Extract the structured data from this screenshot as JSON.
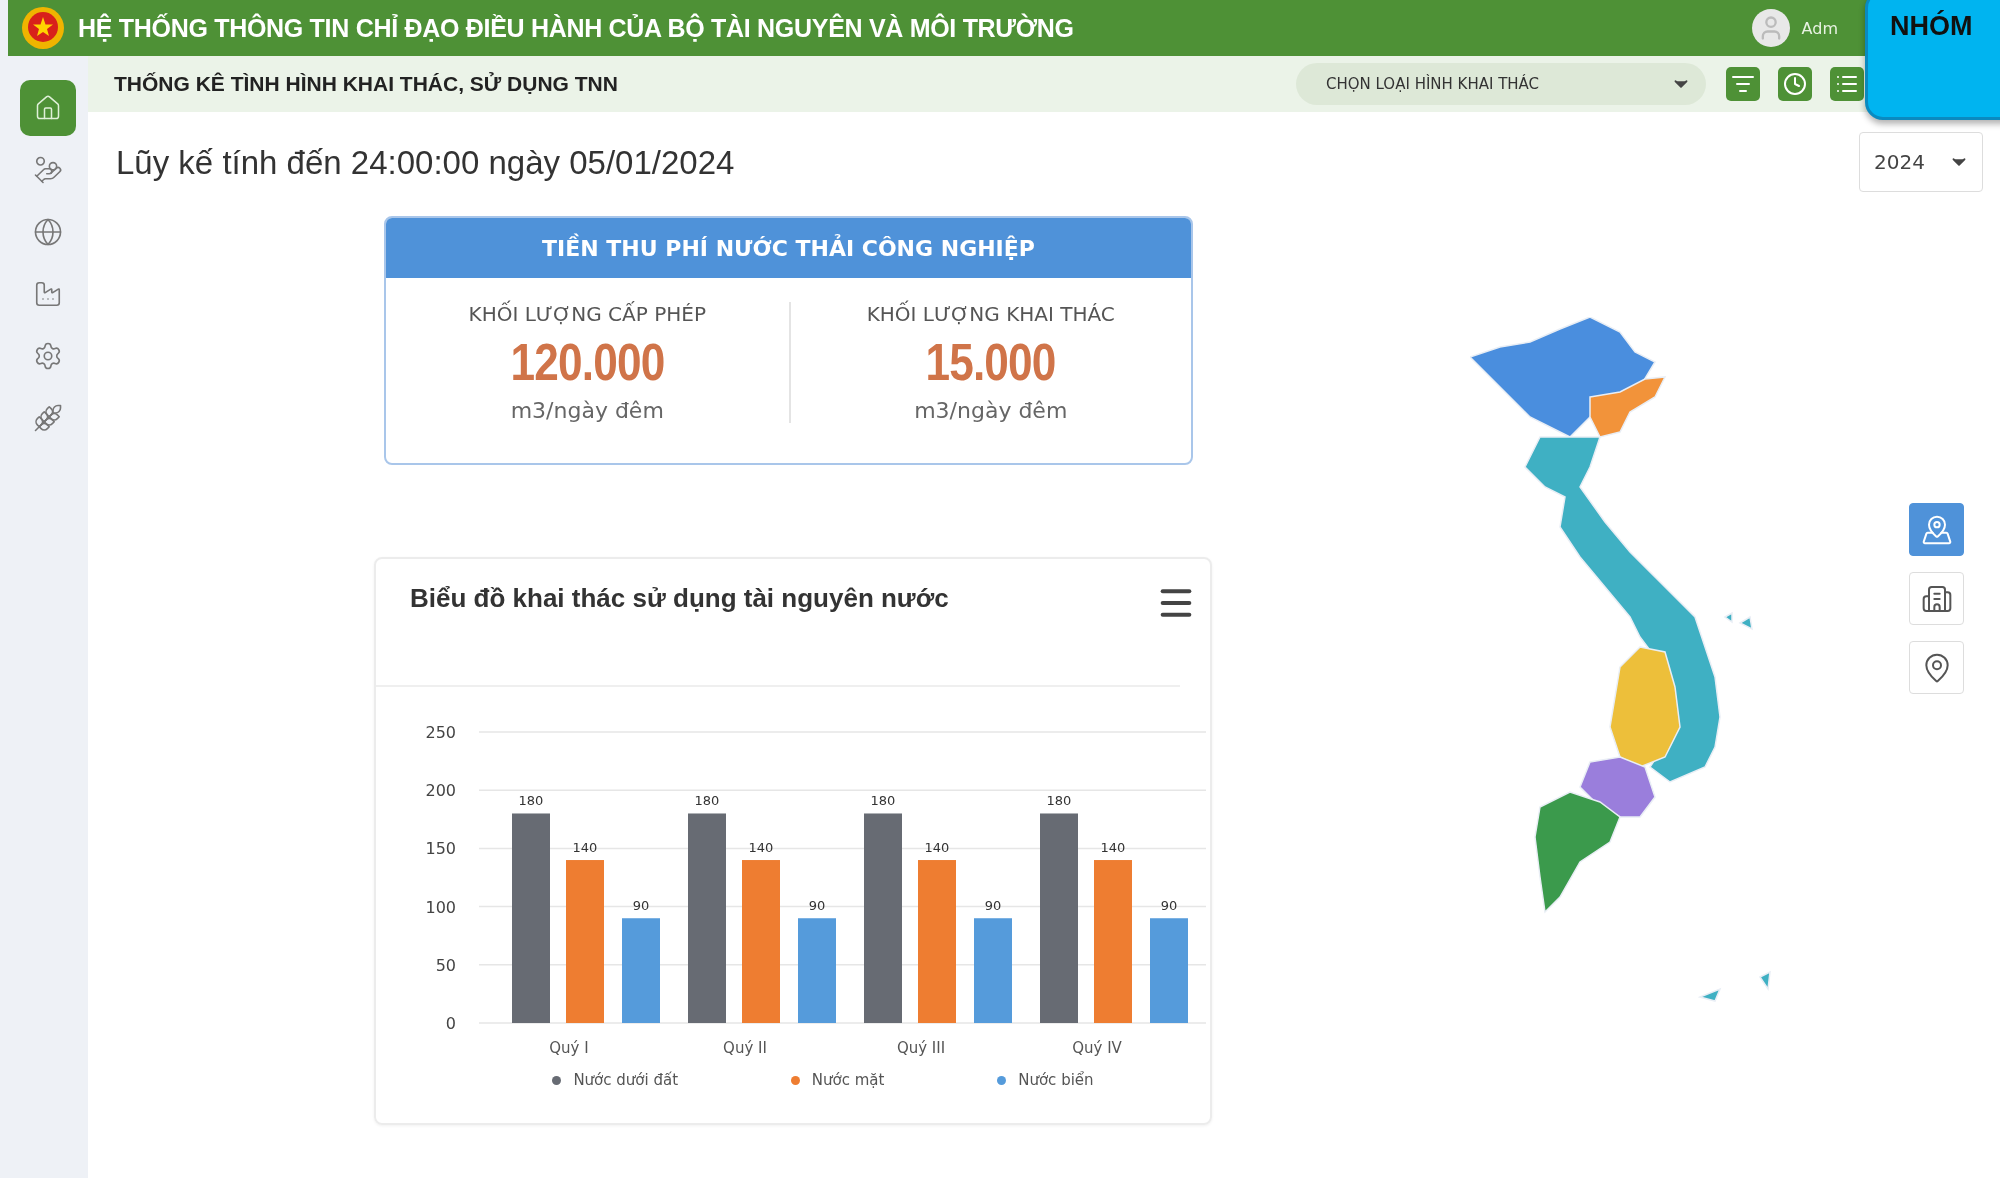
{
  "header": {
    "title": "HỆ THỐNG THÔNG TIN CHỈ ĐẠO ĐIỀU HÀNH CỦA BỘ TÀI NGUYÊN VÀ MÔI TRƯỜNG",
    "user": "Adm"
  },
  "overlay": {
    "text": "NHÓM"
  },
  "subheader": {
    "title": "THỐNG KÊ TÌNH HÌNH KHAI THÁC, SỬ DỤNG TNN",
    "select": {
      "value": "CHỌN LOẠI HÌNH KHAI THÁC"
    }
  },
  "sidebar": {
    "items": [
      {
        "kind": "home",
        "selected": true
      },
      {
        "kind": "coins",
        "selected": false
      },
      {
        "kind": "globe",
        "selected": false
      },
      {
        "kind": "factory",
        "selected": false
      },
      {
        "kind": "gear",
        "selected": false
      },
      {
        "kind": "wheat",
        "selected": false
      }
    ]
  },
  "page_title": "Lũy kế tính đến 24:00:00 ngày 05/01/2024",
  "year_select": {
    "value": "2024"
  },
  "stat_card": {
    "title": "TIỀN THU PHÍ NƯỚC THẢI CÔNG NGHIỆP",
    "stats": [
      {
        "label": "KHỐI LƯỢNG CẤP PHÉP",
        "value": "120.000",
        "unit": "m3/ngày đêm"
      },
      {
        "label": "KHỐI LƯỢNG KHAI THÁC",
        "value": "15.000",
        "unit": "m3/ngày đêm"
      }
    ]
  },
  "chart_card": {
    "title": "Biểu đồ khai thác sử dụng tài nguyên nước",
    "chart_data": {
      "type": "bar",
      "categories": [
        "Quý I",
        "Quý II",
        "Quý III",
        "Quý IV"
      ],
      "ylim": [
        0,
        250
      ],
      "grid": true,
      "yticks": [
        0,
        50,
        100,
        150,
        200,
        250
      ],
      "data_labels": true,
      "series": [
        {
          "name": "Nước dưới đất",
          "color": "#676b73",
          "values": [
            180,
            180,
            180,
            180
          ]
        },
        {
          "name": "Nước mặt",
          "color": "#ee7d31",
          "values": [
            140,
            140,
            140,
            140
          ]
        },
        {
          "name": "Nước biển",
          "color": "#559bdb",
          "values": [
            90,
            90,
            90,
            90
          ]
        }
      ]
    }
  },
  "map_tools": [
    {
      "kind": "map",
      "selected": true
    },
    {
      "kind": "building-pin",
      "selected": false
    },
    {
      "kind": "pin",
      "selected": false
    }
  ]
}
